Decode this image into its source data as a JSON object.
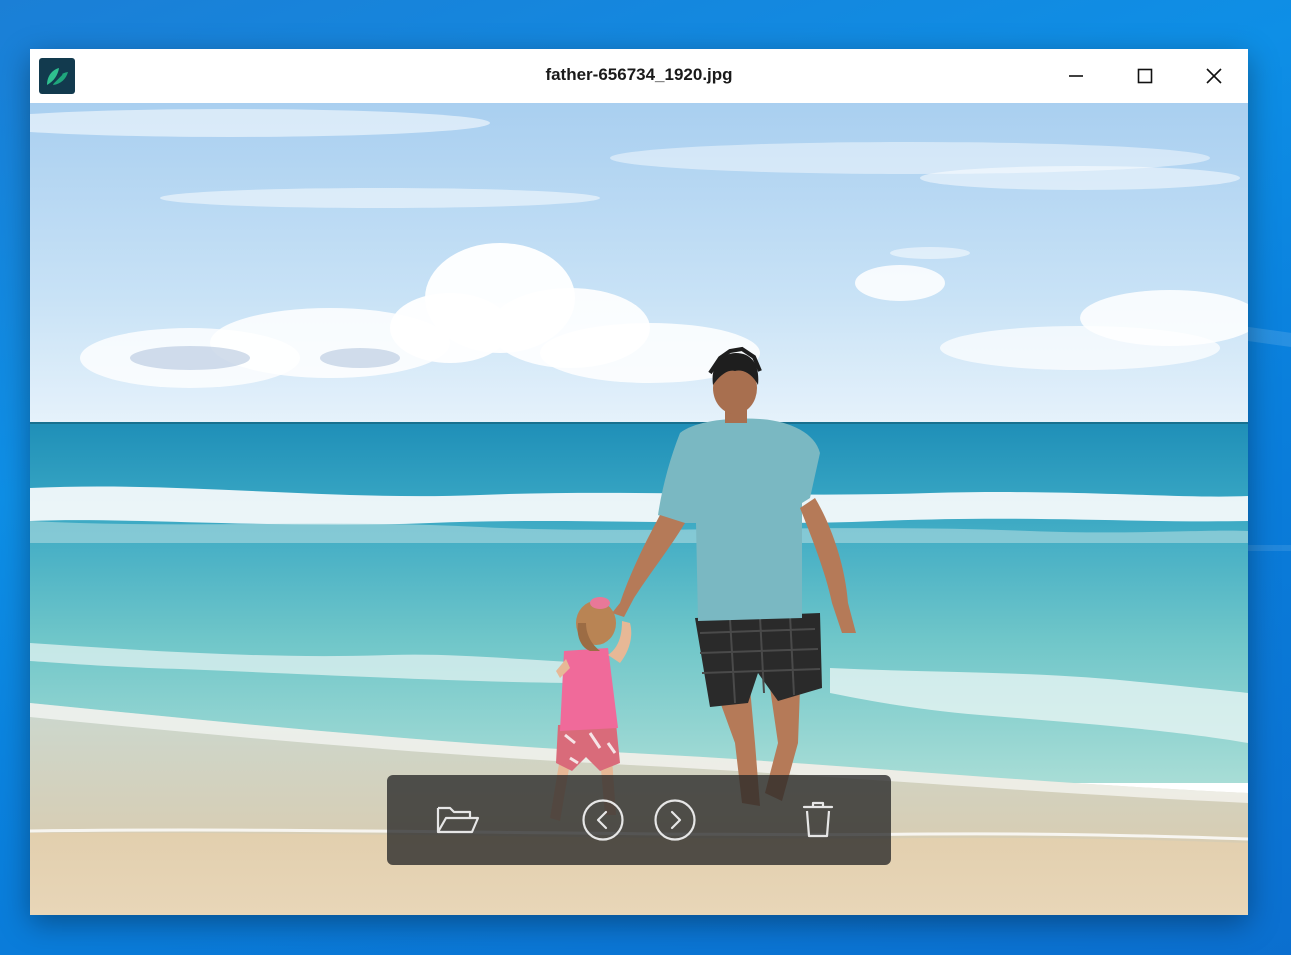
{
  "window": {
    "title": "father-656734_1920.jpg",
    "app_icon": "leaf-app-icon"
  },
  "titlebar_controls": {
    "minimize_icon": "minimize-icon",
    "maximize_icon": "maximize-icon",
    "close_icon": "close-icon"
  },
  "viewer": {
    "image_subject": "father and daughter walking into the sea on a beach",
    "toolbar": [
      {
        "name": "open-folder",
        "icon": "folder-open-icon"
      },
      {
        "name": "previous",
        "icon": "chevron-left-circle-icon"
      },
      {
        "name": "next",
        "icon": "chevron-right-circle-icon"
      },
      {
        "name": "delete",
        "icon": "trash-icon"
      }
    ]
  },
  "colors": {
    "app_icon_bg": "#123a4e",
    "app_icon_leaf": "#2fc08f",
    "toolbar_bg": "#282828",
    "toolbar_icon": "#e6e6e6",
    "desktop": "#0e8fe6"
  }
}
